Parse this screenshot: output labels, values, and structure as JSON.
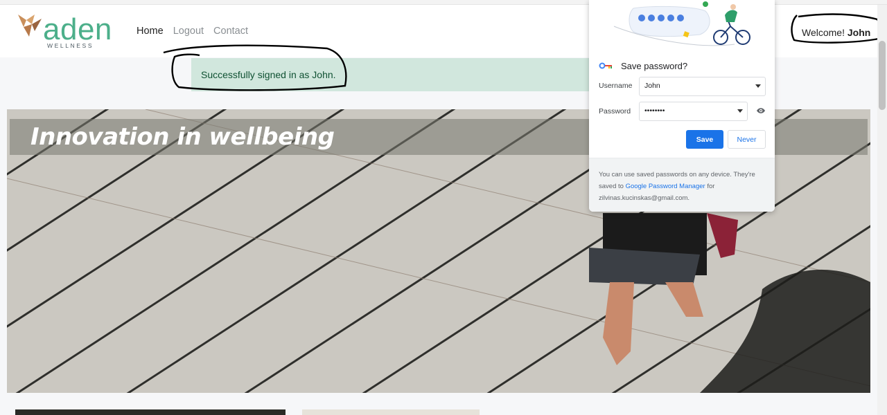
{
  "brand": {
    "name": "aden",
    "tagline": "WELLNESS",
    "color": "#4caf8a"
  },
  "nav": {
    "items": [
      {
        "label": "Home",
        "active": true
      },
      {
        "label": "Logout",
        "active": false
      },
      {
        "label": "Contact",
        "active": false
      }
    ]
  },
  "user": {
    "welcome_prefix": "Welcome!",
    "name": "John"
  },
  "alert": {
    "text": "Successfully signed in as John.",
    "color": "#d1e7dd"
  },
  "hero": {
    "title": "Innovation in wellbeing"
  },
  "password_prompt": {
    "title": "Save password?",
    "username_label": "Username",
    "username_value": "John",
    "password_label": "Password",
    "password_value": "••••••••",
    "save_label": "Save",
    "never_label": "Never",
    "footer_text_before": "You can use saved passwords on any device. They're saved to ",
    "footer_link": "Google Password Manager",
    "footer_text_after": " for zilvinas.kucinskas@gmail.com.",
    "accent": "#1a73e8"
  },
  "icons": [
    "origami-bird-logo-icon",
    "key-icon",
    "eye-icon",
    "dropdown-caret-icon",
    "cyclist-illustration"
  ]
}
